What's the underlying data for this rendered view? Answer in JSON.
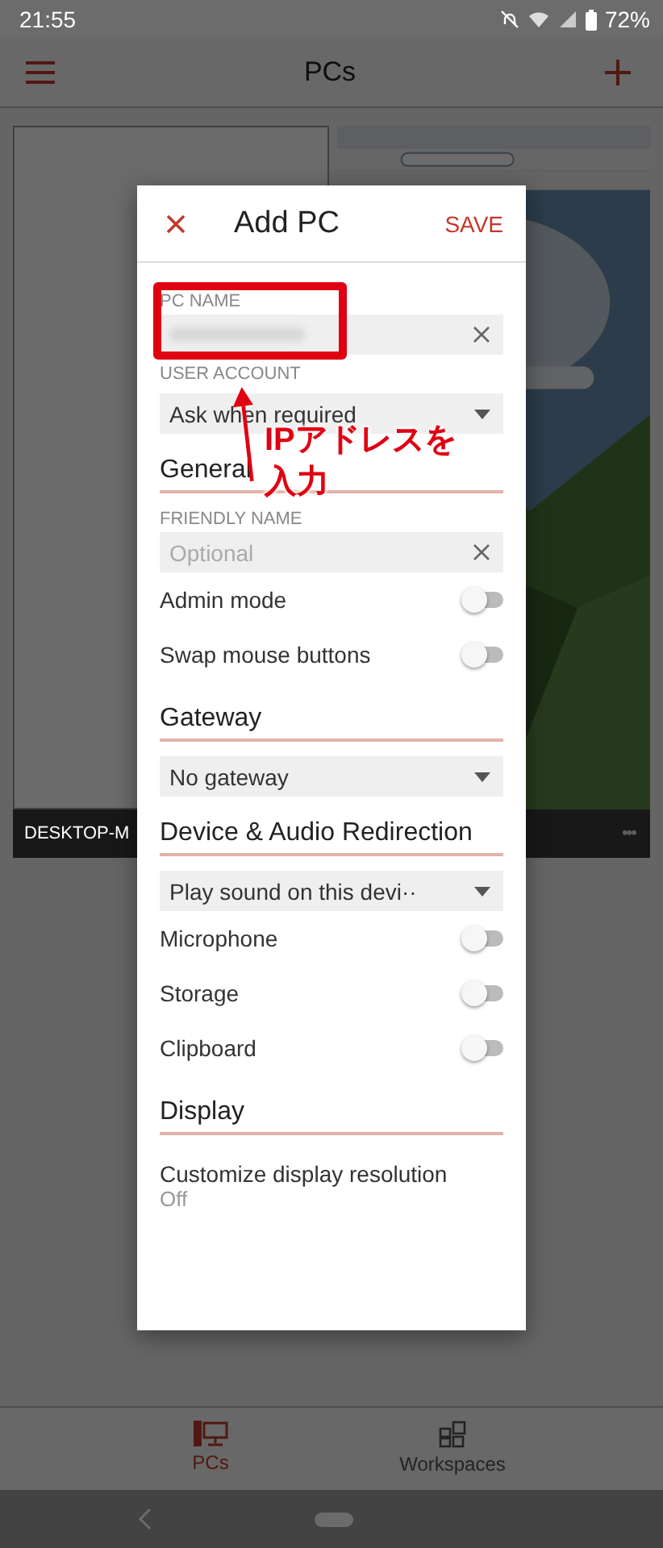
{
  "status_bar": {
    "time": "21:55",
    "battery": "72%"
  },
  "app_bar": {
    "title": "PCs"
  },
  "pcs": [
    {
      "kind": "blank",
      "label": "DESKTOP-M"
    },
    {
      "kind": "picture",
      "menu": "•••"
    }
  ],
  "bottom_nav": [
    {
      "label": "PCs",
      "selected": true
    },
    {
      "label": "Workspaces",
      "selected": false
    }
  ],
  "dialog": {
    "title": "Add PC",
    "save": "SAVE",
    "items": [
      {
        "kind": "text_field",
        "label": "PC NAME",
        "blurred": true
      },
      {
        "kind": "dropdown",
        "label": "USER ACCOUNT",
        "value": "Ask when required"
      },
      {
        "kind": "heading",
        "text": "General"
      },
      {
        "kind": "text_field",
        "label": "FRIENDLY NAME",
        "placeholder": "Optional",
        "blurred": false
      },
      {
        "kind": "toggle",
        "label": "Admin mode",
        "on": false
      },
      {
        "kind": "toggle",
        "label": "Swap mouse buttons",
        "on": false
      },
      {
        "kind": "heading",
        "text": "Gateway"
      },
      {
        "kind": "dropdown",
        "value": "No gateway"
      },
      {
        "kind": "heading",
        "text": "Device & Audio Redirection"
      },
      {
        "kind": "dropdown",
        "value": "Play sound on this devi··"
      },
      {
        "kind": "toggle",
        "label": "Microphone",
        "on": false
      },
      {
        "kind": "toggle",
        "label": "Storage",
        "on": false
      },
      {
        "kind": "toggle",
        "label": "Clipboard",
        "on": false
      },
      {
        "kind": "heading",
        "text": "Display"
      },
      {
        "kind": "setting",
        "label": "Customize display resolution",
        "value": "Off"
      }
    ]
  },
  "annotation": {
    "text": "IPアドレスを入力"
  }
}
